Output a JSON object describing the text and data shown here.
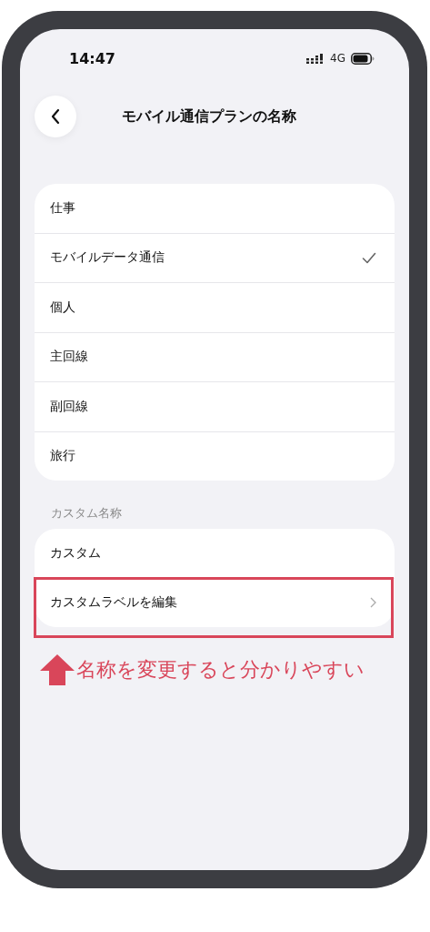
{
  "status_bar": {
    "time": "14:47",
    "network": "4G"
  },
  "nav": {
    "title": "モバイル通信プランの名称"
  },
  "plan_names": [
    {
      "label": "仕事",
      "selected": false
    },
    {
      "label": "モバイルデータ通信",
      "selected": true
    },
    {
      "label": "個人",
      "selected": false
    },
    {
      "label": "主回線",
      "selected": false
    },
    {
      "label": "副回線",
      "selected": false
    },
    {
      "label": "旅行",
      "selected": false
    }
  ],
  "custom_section": {
    "header": "カスタム名称",
    "items": [
      {
        "label": "カスタム",
        "kind": "plain",
        "highlighted": false
      },
      {
        "label": "カスタムラベルを編集",
        "kind": "link",
        "highlighted": true
      }
    ]
  },
  "annotation": {
    "text": "名称を変更すると分かりやすい"
  }
}
